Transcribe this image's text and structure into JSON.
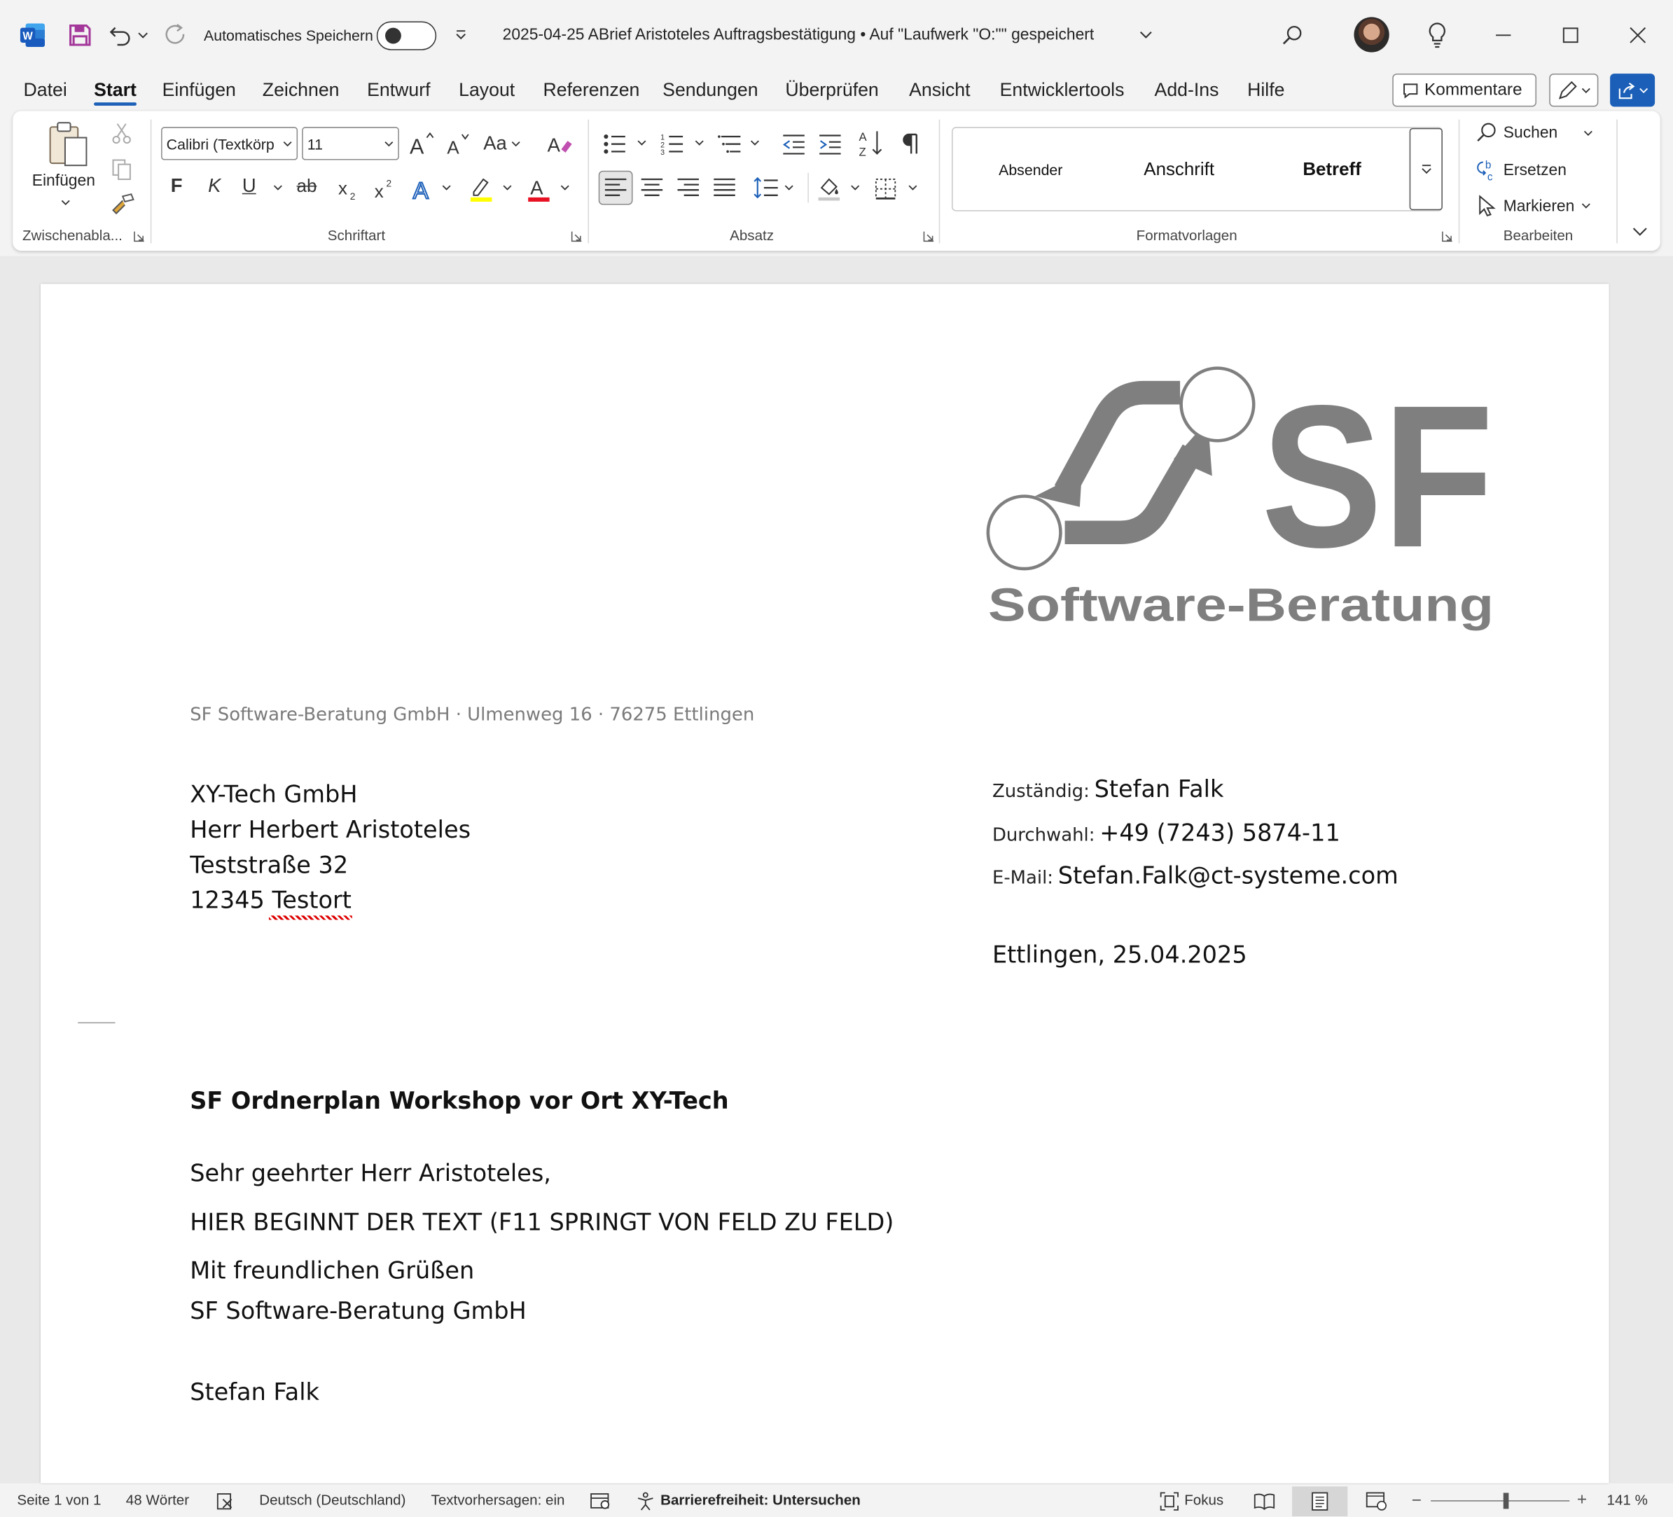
{
  "titlebar": {
    "autosave_label": "Automatisches Speichern",
    "title": "2025-04-25 ABrief Aristoteles Auftragsbestätigung • Auf \"Laufwerk \"O:\"\" gespeichert"
  },
  "tabs": [
    "Datei",
    "Start",
    "Einfügen",
    "Zeichnen",
    "Entwurf",
    "Layout",
    "Referenzen",
    "Sendungen",
    "Überprüfen",
    "Ansicht",
    "Entwicklertools",
    "Add-Ins",
    "Hilfe"
  ],
  "comments_label": "Kommentare",
  "ribbon": {
    "clipboard": {
      "paste_label": "Einfügen",
      "group_label": "Zwischenabla..."
    },
    "font": {
      "font_name": "Calibri (Textkörp",
      "font_size": "11",
      "case_label": "Aa",
      "bold": "F",
      "italic": "K",
      "underline": "U",
      "strike": "ab",
      "group_label": "Schriftart"
    },
    "paragraph": {
      "group_label": "Absatz"
    },
    "styles": {
      "items": [
        "Absender",
        "Anschrift",
        "Betreff"
      ],
      "group_label": "Formatvorlagen"
    },
    "editing": {
      "find": "Suchen",
      "replace": "Ersetzen",
      "select": "Markieren",
      "group_label": "Bearbeiten"
    }
  },
  "document": {
    "logo": {
      "letters": "SF",
      "tagline": "Software-Beratung"
    },
    "sender_line": "SF Software-Beratung GmbH · Ulmenweg 16 · 76275 Ettlingen",
    "recipient": [
      "XY-Tech GmbH",
      "Herr Herbert Aristoteles",
      "Teststraße 32",
      "12345 Testort"
    ],
    "contact": [
      {
        "label": "Zuständig:",
        "value": "Stefan Falk"
      },
      {
        "label": "Durchwahl:",
        "value": "+49 (7243) 5874-11"
      },
      {
        "label": "E-Mail:",
        "value": "Stefan.Falk@ct-systeme.com"
      }
    ],
    "date": "Ettlingen, 25.04.2025",
    "subject": "SF Ordnerplan Workshop vor Ort XY-Tech",
    "salutation": "Sehr geehrter Herr Aristoteles,",
    "body": "HIER BEGINNT DER TEXT (F11 SPRINGT VON FELD ZU FELD)",
    "closing": "Mit freundlichen Grüßen",
    "company": "SF Software-Beratung GmbH",
    "signature": "Stefan Falk"
  },
  "statusbar": {
    "page": "Seite 1 von 1",
    "words": "48 Wörter",
    "language": "Deutsch (Deutschland)",
    "predictions": "Textvorhersagen: ein",
    "accessibility": "Barrierefreiheit: Untersuchen",
    "focus": "Fokus",
    "zoom": "141 %",
    "zoom_level_percent": 141
  },
  "colors": {
    "accent": "#1b5fb8",
    "word_blue": "#185abd",
    "logo_gray": "#7f7f7f",
    "highlight": "#ffff00",
    "font_color": "#e81123"
  }
}
